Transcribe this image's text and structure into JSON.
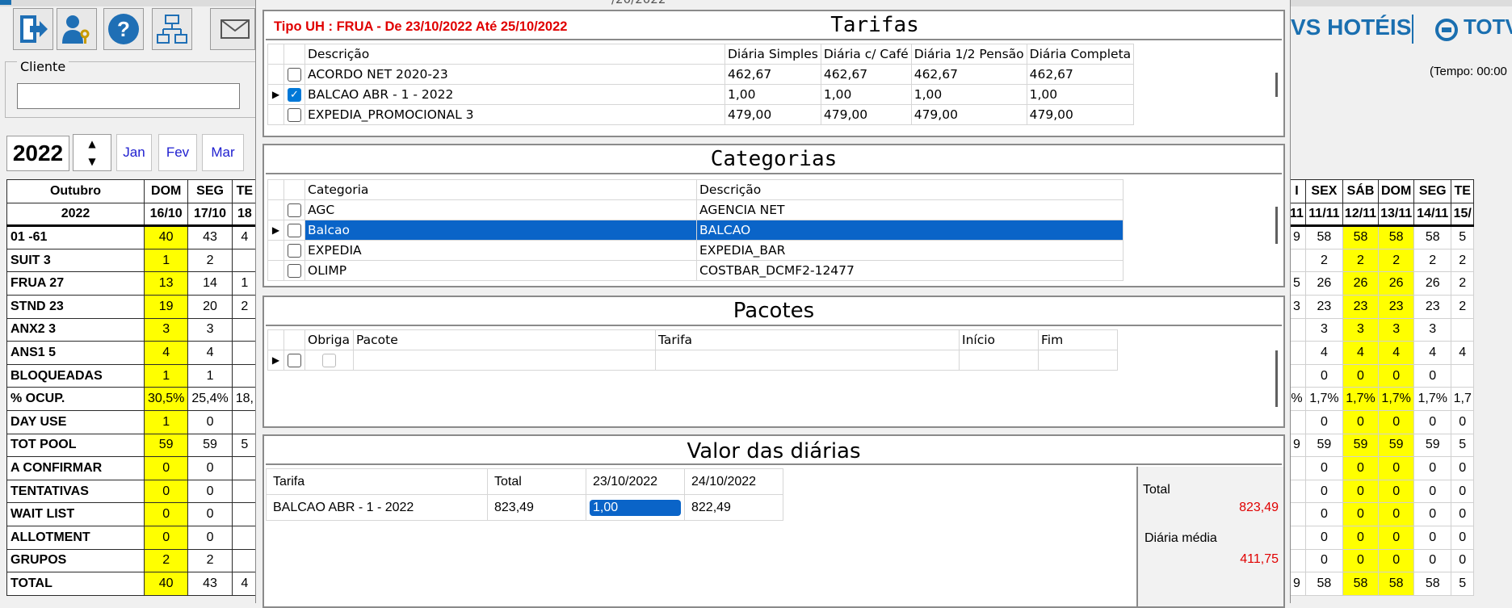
{
  "top_row": {
    "center_fragment": "/20/2022"
  },
  "toolbar": {
    "icons": [
      "exit-icon",
      "user-key-icon",
      "help-icon",
      "network-icon",
      "mail-icon"
    ]
  },
  "cliente": {
    "label": "Cliente",
    "value": ""
  },
  "calendar": {
    "year": "2022",
    "months": [
      "Jan",
      "Fev",
      "Mar"
    ],
    "month_header": "Outubro",
    "year_header": "2022",
    "left_days": [
      {
        "dow": "DOM",
        "date": "16/10"
      },
      {
        "dow": "SEG",
        "date": "17/10"
      },
      {
        "dow": "TE",
        "date": "18"
      }
    ],
    "right_days": [
      {
        "dow": "I",
        "date": "11"
      },
      {
        "dow": "SEX",
        "date": "11/11"
      },
      {
        "dow": "SÁB",
        "date": "12/11"
      },
      {
        "dow": "DOM",
        "date": "13/11"
      },
      {
        "dow": "SEG",
        "date": "14/11"
      },
      {
        "dow": "TE",
        "date": "15/"
      }
    ],
    "rows": [
      {
        "label": "01 -61",
        "l": [
          "40",
          "43",
          "4"
        ],
        "r": [
          "9",
          "58",
          "58",
          "58",
          "58",
          "5"
        ]
      },
      {
        "label": "SUIT 3",
        "l": [
          "1",
          "2",
          ""
        ],
        "r": [
          "",
          "2",
          "2",
          "2",
          "2",
          "2"
        ]
      },
      {
        "label": "FRUA 27",
        "l": [
          "13",
          "14",
          "1"
        ],
        "r": [
          "5",
          "26",
          "26",
          "26",
          "26",
          "2"
        ]
      },
      {
        "label": "STND 23",
        "l": [
          "19",
          "20",
          "2"
        ],
        "r": [
          "3",
          "23",
          "23",
          "23",
          "23",
          "2"
        ]
      },
      {
        "label": "ANX2 3",
        "l": [
          "3",
          "3",
          ""
        ],
        "r": [
          "",
          "3",
          "3",
          "3",
          "3",
          ""
        ]
      },
      {
        "label": "ANS1 5",
        "l": [
          "4",
          "4",
          ""
        ],
        "r": [
          "",
          "4",
          "4",
          "4",
          "4",
          "4"
        ]
      },
      {
        "label": "BLOQUEADAS",
        "l": [
          "1",
          "1",
          ""
        ],
        "r": [
          "",
          "0",
          "0",
          "0",
          "0",
          ""
        ]
      },
      {
        "label": "% OCUP.",
        "l": [
          "30,5%",
          "25,4%",
          "18,"
        ],
        "r": [
          "%",
          "1,7%",
          "1,7%",
          "1,7%",
          "1,7%",
          "1,7"
        ]
      },
      {
        "label": "DAY USE",
        "l": [
          "1",
          "0",
          ""
        ],
        "r": [
          "",
          "0",
          "0",
          "0",
          "0",
          "0"
        ]
      },
      {
        "label": "TOT POOL",
        "l": [
          "59",
          "59",
          "5"
        ],
        "r": [
          "9",
          "59",
          "59",
          "59",
          "59",
          "5"
        ]
      },
      {
        "label": "A CONFIRMAR",
        "l": [
          "0",
          "0",
          ""
        ],
        "r": [
          "",
          "0",
          "0",
          "0",
          "0",
          "0"
        ]
      },
      {
        "label": "TENTATIVAS",
        "l": [
          "0",
          "0",
          ""
        ],
        "r": [
          "",
          "0",
          "0",
          "0",
          "0",
          "0"
        ]
      },
      {
        "label": "WAIT LIST",
        "l": [
          "0",
          "0",
          ""
        ],
        "r": [
          "",
          "0",
          "0",
          "0",
          "0",
          "0"
        ]
      },
      {
        "label": "ALLOTMENT",
        "l": [
          "0",
          "0",
          ""
        ],
        "r": [
          "",
          "0",
          "0",
          "0",
          "0",
          "0"
        ]
      },
      {
        "label": "GRUPOS",
        "l": [
          "2",
          "2",
          ""
        ],
        "r": [
          "",
          "0",
          "0",
          "0",
          "0",
          "0"
        ]
      },
      {
        "label": "TOTAL",
        "l": [
          "40",
          "43",
          "4"
        ],
        "r": [
          "9",
          "58",
          "58",
          "58",
          "58",
          "5"
        ]
      }
    ]
  },
  "brand": {
    "left": "VS HOTÉIS",
    "right": "TOTV"
  },
  "tempo": "(Tempo: 00:00",
  "colors": {
    "yellow": "#ffff00",
    "selection": "#0a64c8",
    "red": "#e00000",
    "brand": "#1a6fb0"
  },
  "tarifas": {
    "title": "Tarifas",
    "subtitle": "Tipo UH : FRUA - De 23/10/2022 Até 25/10/2022",
    "columns": [
      "Descrição",
      "Diária Simples",
      "Diária c/ Café",
      "Diária 1/2 Pensão",
      "Diária Completa"
    ],
    "rows": [
      {
        "checked": false,
        "current": false,
        "cells": [
          "ACORDO NET 2020-23",
          "462,67",
          "462,67",
          "462,67",
          "462,67"
        ]
      },
      {
        "checked": true,
        "current": true,
        "cells": [
          "BALCAO ABR - 1 - 2022",
          "1,00",
          "1,00",
          "1,00",
          "1,00"
        ]
      },
      {
        "checked": false,
        "current": false,
        "cells": [
          "EXPEDIA_PROMOCIONAL 3",
          "479,00",
          "479,00",
          "479,00",
          "479,00"
        ]
      }
    ]
  },
  "categorias": {
    "title": "Categorias",
    "columns": [
      "Categoria",
      "Descrição"
    ],
    "rows": [
      {
        "checked": false,
        "selected": false,
        "cells": [
          "AGC",
          "AGENCIA NET"
        ]
      },
      {
        "checked": true,
        "selected": true,
        "cells": [
          "Balcao",
          "BALCAO"
        ]
      },
      {
        "checked": false,
        "selected": false,
        "cells": [
          "EXPEDIA",
          "EXPEDIA_BAR"
        ]
      },
      {
        "checked": false,
        "selected": false,
        "cells": [
          "OLIMP",
          "COSTBAR_DCMF2-12477"
        ]
      }
    ]
  },
  "pacotes": {
    "title": "Pacotes",
    "columns": [
      "Obriga",
      "Pacote",
      "Tarifa",
      "Início",
      "Fim"
    ]
  },
  "valor": {
    "title": "Valor das diárias",
    "columns": [
      "Tarifa",
      "Total",
      "23/10/2022",
      "24/10/2022"
    ],
    "row": [
      "BALCAO ABR - 1 - 2022",
      "823,49",
      "1,00",
      "822,49"
    ],
    "total_label": "Total",
    "total_value": "823,49",
    "media_label": "Diária média",
    "media_value": "411,75"
  }
}
